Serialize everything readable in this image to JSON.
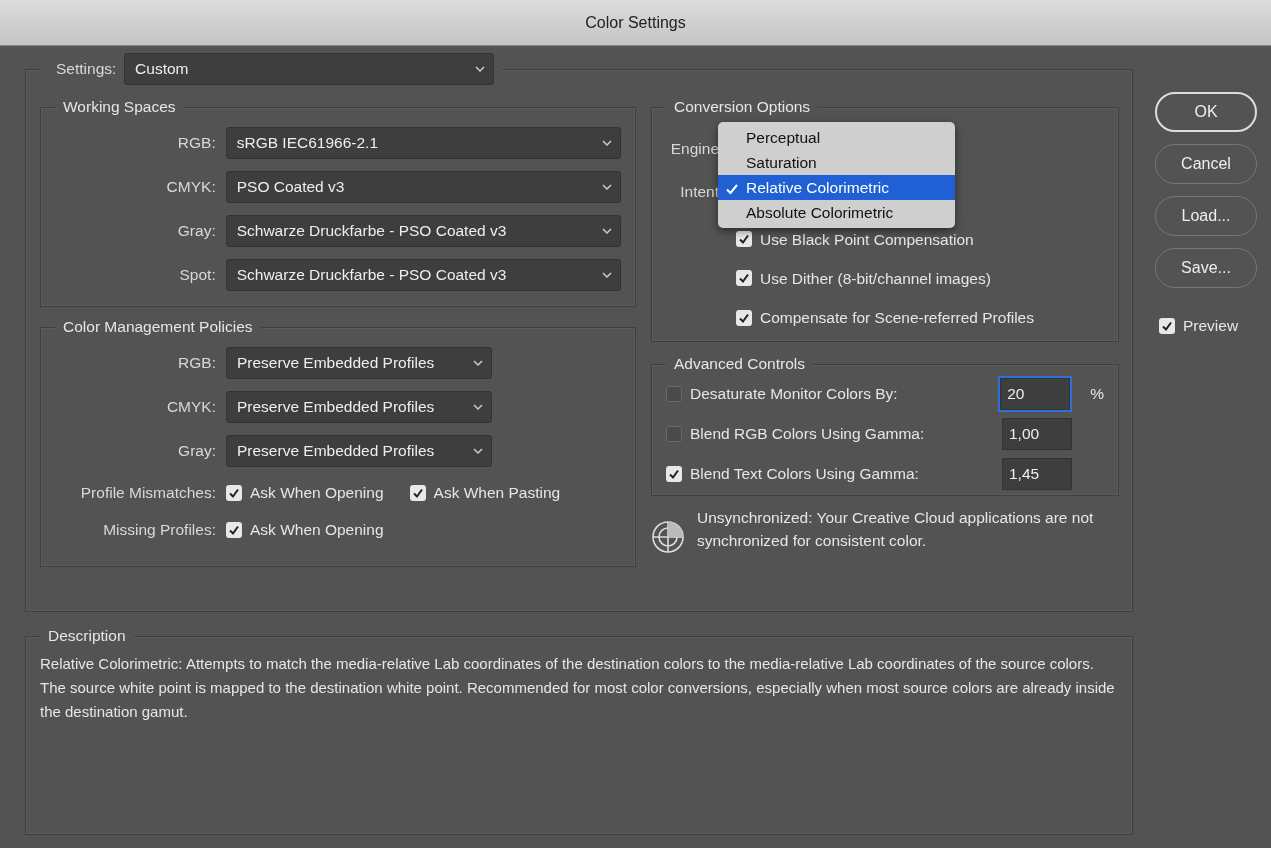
{
  "window": {
    "title": "Color Settings"
  },
  "settings": {
    "label": "Settings:",
    "value": "Custom"
  },
  "working_spaces": {
    "title": "Working Spaces",
    "rows": [
      {
        "label": "RGB:",
        "value": "sRGB IEC61966-2.1"
      },
      {
        "label": "CMYK:",
        "value": "PSO Coated v3"
      },
      {
        "label": "Gray:",
        "value": "Schwarze Druckfarbe - PSO Coated v3"
      },
      {
        "label": "Spot:",
        "value": "Schwarze Druckfarbe - PSO Coated v3"
      }
    ]
  },
  "policies": {
    "title": "Color Management Policies",
    "rows": [
      {
        "label": "RGB:",
        "value": "Preserve Embedded Profiles"
      },
      {
        "label": "CMYK:",
        "value": "Preserve Embedded Profiles"
      },
      {
        "label": "Gray:",
        "value": "Preserve Embedded Profiles"
      }
    ],
    "checks": [
      {
        "label": "Profile Mismatches:",
        "options": [
          {
            "label": "Ask When Opening",
            "checked": true
          },
          {
            "label": "Ask When Pasting",
            "checked": true
          }
        ]
      },
      {
        "label": "Missing Profiles:",
        "options": [
          {
            "label": "Ask When Opening",
            "checked": true
          }
        ]
      }
    ]
  },
  "conversion": {
    "title": "Conversion Options",
    "engine_label": "Engine",
    "intent_label": "Intent",
    "options": [
      {
        "label": "Use Black Point Compensation",
        "checked": true
      },
      {
        "label": "Use Dither (8-bit/channel images)",
        "checked": true
      },
      {
        "label": "Compensate for Scene-referred Profiles",
        "checked": true
      }
    ],
    "menu": [
      {
        "label": "Perceptual",
        "selected": false
      },
      {
        "label": "Saturation",
        "selected": false
      },
      {
        "label": "Relative Colorimetric",
        "selected": true
      },
      {
        "label": "Absolute Colorimetric",
        "selected": false
      }
    ]
  },
  "advanced": {
    "title": "Advanced Controls",
    "rows": [
      {
        "label": "Desaturate Monitor Colors By:",
        "checked": false,
        "value": "20",
        "focused": true,
        "unit": "%"
      },
      {
        "label": "Blend RGB Colors Using Gamma:",
        "checked": false,
        "value": "1,00",
        "focused": false
      },
      {
        "label": "Blend Text Colors Using Gamma:",
        "checked": true,
        "value": "1,45",
        "focused": false
      }
    ]
  },
  "sync": {
    "text": "Unsynchronized: Your Creative Cloud applications are not synchronized for consistent color."
  },
  "description": {
    "title": "Description",
    "text": "Relative Colorimetric:  Attempts to match the media-relative Lab coordinates of the destination colors to the media-relative Lab coordinates of the source colors.  The source white point is mapped to the destination white point.  Recommended for most color conversions, especially when most source colors are already inside the destination gamut."
  },
  "buttons": [
    {
      "label": "OK",
      "default": true
    },
    {
      "label": "Cancel",
      "default": false
    },
    {
      "label": "Load...",
      "default": false
    },
    {
      "label": "Save...",
      "default": false
    }
  ],
  "preview": {
    "label": "Preview",
    "checked": true
  }
}
